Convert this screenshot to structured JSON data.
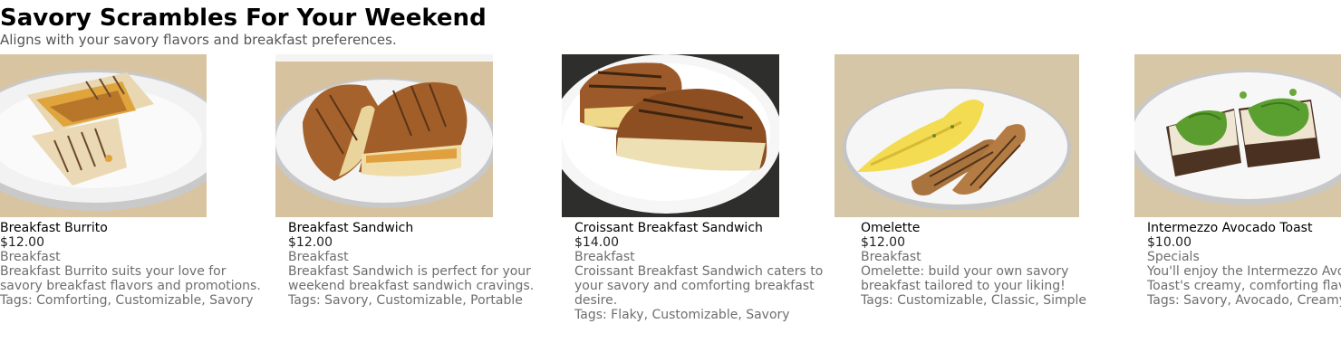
{
  "header": {
    "title": "Savory Scrambles For Your Weekend",
    "subtitle": "Aligns with your savory flavors and breakfast preferences."
  },
  "items": [
    {
      "name": "Breakfast Burrito",
      "price": "$12.00",
      "category": "Breakfast",
      "desc_lines": [
        "Breakfast Burrito suits your love for",
        "savory breakfast flavors and promotions."
      ],
      "tags": "Tags: Comforting, Customizable, Savory",
      "image": "burrito-photo"
    },
    {
      "name": "Breakfast Sandwich",
      "price": "$12.00",
      "category": "Breakfast",
      "desc_lines": [
        "Breakfast Sandwich is perfect for your",
        "weekend breakfast sandwich cravings."
      ],
      "tags": "Tags: Savory, Customizable, Portable",
      "image": "sandwich-photo"
    },
    {
      "name": "Croissant Breakfast Sandwich",
      "price": "$14.00",
      "category": "Breakfast",
      "desc_lines": [
        "Croissant Breakfast Sandwich caters to",
        "your savory and comforting breakfast",
        "desire."
      ],
      "tags": "Tags: Flaky, Customizable, Savory",
      "image": "croissant-sandwich-photo"
    },
    {
      "name": "Omelette",
      "price": "$12.00",
      "category": "Breakfast",
      "desc_lines": [
        "Omelette: build your own savory",
        "breakfast tailored to your liking!"
      ],
      "tags": "Tags: Customizable, Classic, Simple",
      "image": "omelette-photo"
    },
    {
      "name": "Intermezzo Avocado Toast",
      "price": "$10.00",
      "category": "Specials",
      "desc_lines": [
        "You'll enjoy the Intermezzo Avocado",
        "Toast's creamy, comforting flavors."
      ],
      "tags": "Tags: Savory, Avocado, Creamy",
      "image": "avocado-toast-photo"
    }
  ]
}
